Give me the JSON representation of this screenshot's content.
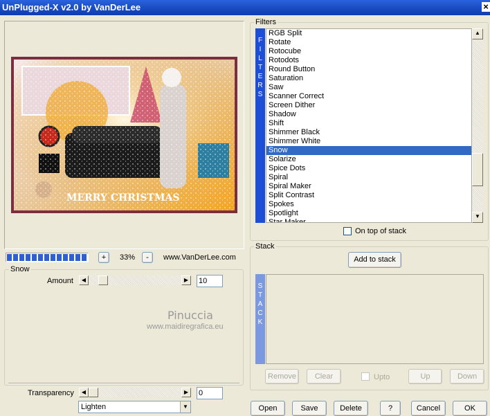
{
  "window": {
    "title": "UnPlugged-X v2.0 by VanDerLee",
    "close_glyph": "×"
  },
  "preview": {
    "greeting_text": "MERRY CHRISTMAS",
    "zoom_minus": "-",
    "zoom_plus": "+",
    "zoom_value": "33%",
    "website": "www.VanDerLee.com",
    "progress_fraction": 1.0
  },
  "snow_group": {
    "label": "Snow",
    "amount_label": "Amount",
    "amount_value": "10"
  },
  "watermark": {
    "name": "Pinuccia",
    "url": "www.maidiregrafica.eu"
  },
  "transparency": {
    "label": "Transparency",
    "value": "0",
    "blend_mode": "Lighten"
  },
  "filters": {
    "label": "Filters",
    "side_letters": [
      "F",
      "I",
      "L",
      "T",
      "E",
      "R",
      "S"
    ],
    "items": [
      "RGB Split",
      "Rotate",
      "Rotocube",
      "Rotodots",
      "Round Button",
      "Saturation",
      "Saw",
      "Scanner Correct",
      "Screen Dither",
      "Shadow",
      "Shift",
      "Shimmer Black",
      "Shimmer White",
      "Snow",
      "Solarize",
      "Spice Dots",
      "Spiral",
      "Spiral Maker",
      "Split Contrast",
      "Spokes",
      "Spotlight",
      "Star Maker"
    ],
    "selected": "Snow",
    "on_top_label": "On top of stack"
  },
  "stack": {
    "label": "Stack",
    "add_button": "Add to stack",
    "side_letters": [
      "S",
      "T",
      "A",
      "C",
      "K"
    ],
    "remove_button": "Remove",
    "clear_button": "Clear",
    "upto_label": "Upto",
    "up_button": "Up",
    "down_button": "Down"
  },
  "footer": {
    "open": "Open",
    "save": "Save",
    "delete": "Delete",
    "help": "?",
    "cancel": "Cancel",
    "ok": "OK"
  },
  "colors": {
    "titlebar": "#1d4fc4",
    "selection": "#316ac5",
    "filters_sidebar": "#1c4ed8",
    "stack_sidebar": "#7b99e0",
    "progress": "#2f5fd0"
  }
}
